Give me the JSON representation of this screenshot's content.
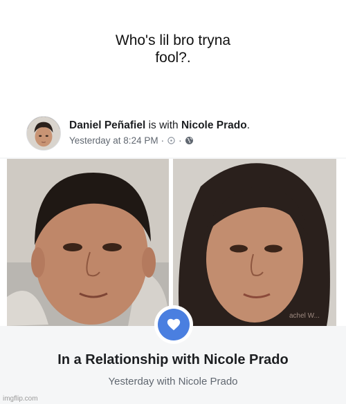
{
  "meme": {
    "caption": "Who's lil bro tryna\nfool?."
  },
  "post": {
    "author": "Daniel Peñafiel",
    "connector": " is with ",
    "tagged": "Nicole Prado",
    "trailing": ".",
    "timestamp": "Yesterday at 8:24 PM",
    "separator": "·",
    "icons": [
      "clock-icon",
      "globe-icon"
    ]
  },
  "photo_right": {
    "watermark_text": "achel W..."
  },
  "relationship": {
    "title": "In a Relationship with Nicole Prado",
    "subtitle": "Yesterday with Nicole Prado",
    "badge_color": "#4a7fe0"
  },
  "site_watermark": "imgflip.com"
}
